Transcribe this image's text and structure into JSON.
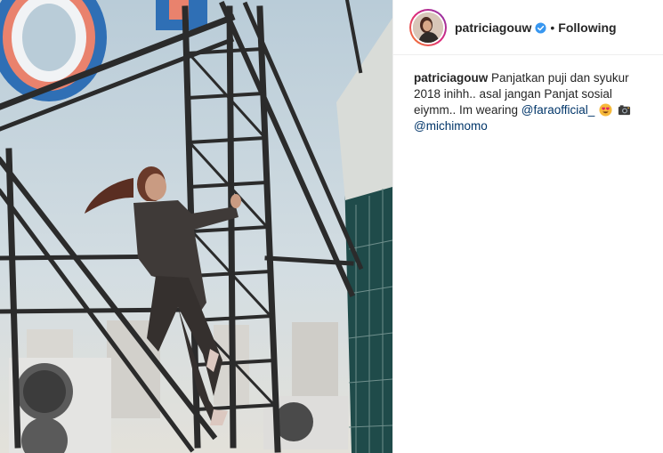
{
  "post": {
    "username": "patriciagouw",
    "verified_icon": "verified-badge-icon",
    "separator": "•",
    "follow_state": "Following"
  },
  "caption": {
    "username": "patriciagouw",
    "text_part1": " Panjatkan puji dan syukur 2018 inihh.. asal jangan Panjat sosial eiymm.. Im wearing ",
    "mention1": "@faraofficial_",
    "mention2": "@michimomo",
    "emoji1": "heart-eyes-emoji-icon",
    "emoji2": "camera-emoji-icon"
  },
  "colors": {
    "accent_blue": "#3897f0",
    "mention_blue": "#003569",
    "text_dark": "#262626",
    "border": "#efefef"
  }
}
